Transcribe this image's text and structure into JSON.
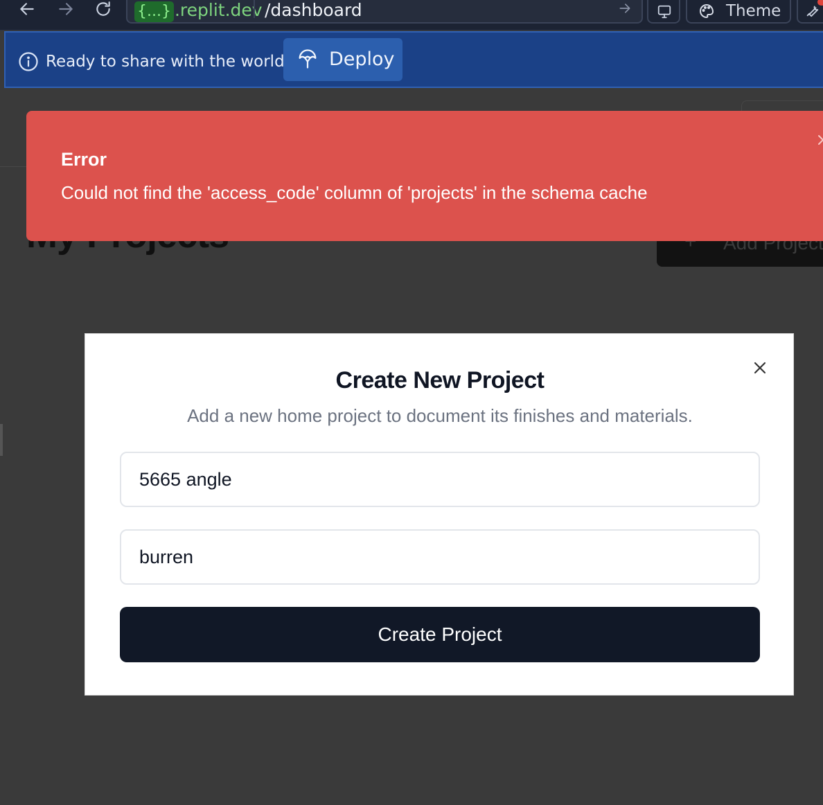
{
  "browser": {
    "url_domain_badge": "{...}",
    "url_domain": ".replit.dev",
    "url_path": "/dashboard",
    "theme_label": "Theme"
  },
  "banner": {
    "message": "Ready to share with the world?",
    "deploy_label": "Deploy",
    "background": "#1b4187"
  },
  "page": {
    "title": "My Projects",
    "add_button_label": "Add Project"
  },
  "toast": {
    "title": "Error",
    "message": "Could not find the 'access_code' column of 'projects' in the schema cache",
    "color": "#dc524d"
  },
  "modal": {
    "title": "Create New Project",
    "description": "Add a new home project to document its finishes and materials.",
    "fields": [
      {
        "value": "5665 angle"
      },
      {
        "value": "burren"
      }
    ],
    "submit_label": "Create Project",
    "submit_color": "#111827"
  }
}
